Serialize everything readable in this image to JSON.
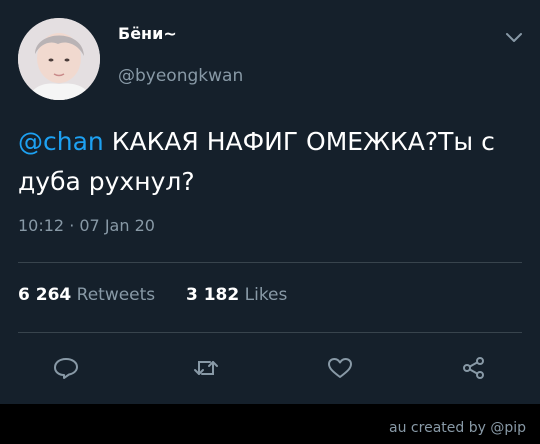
{
  "user": {
    "display_name": "Бёни~",
    "handle": "@byeongkwan"
  },
  "tweet": {
    "mention": "@chan",
    "text_rest": " КАКАЯ НАФИГ ОМЕЖКА?Ты с дуба рухнул?",
    "timestamp": "10:12 · 07 Jan 20"
  },
  "stats": {
    "retweets_count": "6 264",
    "retweets_label": "Retweets",
    "likes_count": "3 182",
    "likes_label": "Likes"
  },
  "actions": {
    "icons": [
      "reply-icon",
      "retweet-icon",
      "like-icon",
      "share-icon"
    ]
  },
  "footer": {
    "credit": "au created by @pip"
  },
  "colors": {
    "background": "#15202b",
    "text": "#ffffff",
    "secondary": "#8899a6",
    "accent": "#1da1f2",
    "divider": "#38444d"
  }
}
